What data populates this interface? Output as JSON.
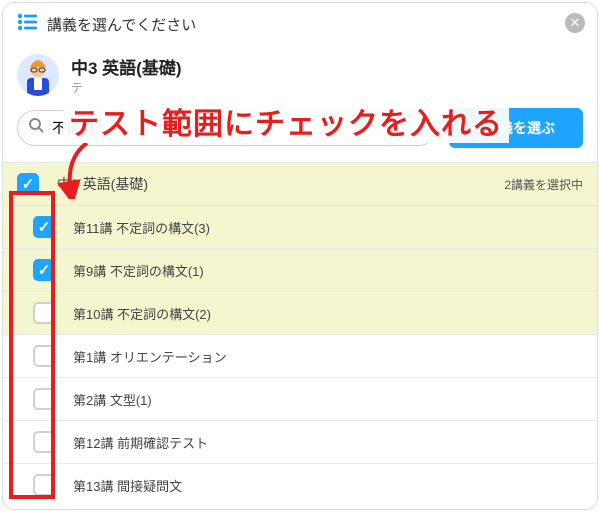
{
  "header": {
    "title": "講義を選んでください"
  },
  "course": {
    "title": "中3 英語(基礎)",
    "subtitle": "テ"
  },
  "annotation": "テスト範囲にチェックを入れる",
  "search": {
    "value": "不定詞",
    "placeholder": ""
  },
  "select_button": "2講義を選ぶ",
  "group": {
    "label": "中3 英語(基礎)",
    "status": "2講義を選択中",
    "checked": true
  },
  "items": [
    {
      "label": "第11講 不定詞の構文(3)",
      "checked": true,
      "highlight": true
    },
    {
      "label": "第9講 不定詞の構文(1)",
      "checked": true,
      "highlight": true
    },
    {
      "label": "第10講 不定詞の構文(2)",
      "checked": false,
      "highlight": true
    },
    {
      "label": "第1講 オリエンテーション",
      "checked": false,
      "highlight": false
    },
    {
      "label": "第2講 文型(1)",
      "checked": false,
      "highlight": false
    },
    {
      "label": "第12講 前期確認テスト",
      "checked": false,
      "highlight": false
    },
    {
      "label": "第13講 間接疑問文",
      "checked": false,
      "highlight": false
    }
  ]
}
